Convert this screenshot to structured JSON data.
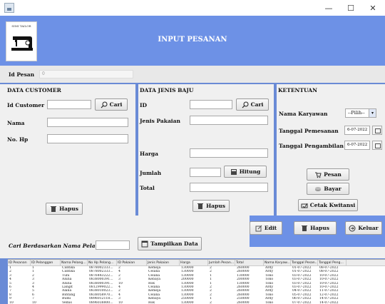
{
  "window": {
    "minimize": "—",
    "maximize": "☐",
    "close": "✕"
  },
  "header": {
    "logo_text": "SIMI TAILOR",
    "title": "INPUT PESANAN"
  },
  "id_pesan": {
    "label": "Id Pesan",
    "value": "0"
  },
  "customer": {
    "title": "DATA CUSTOMER",
    "id_label": "Id Customer",
    "name_label": "Nama",
    "phone_label": "No. Hp",
    "search_button": "Cari",
    "delete_button": "Hapus"
  },
  "clothing": {
    "title": "DATA JENIS BAJU",
    "id_label": "ID",
    "type_label": "Jenis Pakaian",
    "price_label": "Harga",
    "qty_label": "Jumlah",
    "total_label": "Total",
    "search_button": "Cari",
    "count_button": "Hitung",
    "delete_button": "Hapus"
  },
  "terms": {
    "title": "KETENTUAN",
    "employee_label": "Nama Karyawan",
    "employee_value": "--Pilih--",
    "order_date_label": "Tanggal Pemesanan",
    "order_date_value": "6-07-2022",
    "pickup_date_label": "Tanggal Pengambilan",
    "pickup_date_value": "6-07-2022",
    "order_button": "Pesan",
    "pay_button": "Bayar",
    "print_button": "Cetak Kwitansi"
  },
  "actions": {
    "edit": "Edit",
    "delete": "Hapus",
    "exit": "Keluar"
  },
  "search": {
    "label": "Cari Berdasarkan Nama Pelanggan",
    "value": "",
    "show_button": "Tampilkan Data"
  },
  "table": {
    "headers": [
      "ID Pesanan",
      "ID Pelanggan",
      "Nama Pelang...",
      "No Hp Pelang...",
      "ID Pakaian",
      "Jenis Pakaian",
      "Harga",
      "Jumlah Pesan...",
      "Total",
      "Nama Karyaw...",
      "Tanggal Pesan...",
      "Tanggal Peng..."
    ],
    "rows": [
      [
        "1",
        "1",
        "Cantika",
        "0878002333...",
        "2",
        "Kemeja",
        "130000",
        "2",
        "260000",
        "Ardy",
        "01-07-2022",
        "08-07-2022"
      ],
      [
        "2",
        "1",
        "Cantika",
        "0878002333...",
        "4",
        "Celana",
        "130000",
        "2",
        "260000",
        "Ardy",
        "01-07-2022",
        "08-07-2022"
      ],
      [
        "3",
        "2",
        "Tuni",
        "0876443222...",
        "2",
        "Celana",
        "130000",
        "1",
        "130000",
        "Tono",
        "03-07-2022",
        "10-07-2022"
      ],
      [
        "4",
        "3",
        "Aluna",
        "0838000391...",
        "3",
        "Kebaya",
        "200000",
        "1",
        "200000",
        "Tono",
        "03-07-2022",
        "10-07-2022"
      ],
      [
        "5",
        "3",
        "Aluna",
        "0838000391...",
        "10",
        "Rok",
        "130000",
        "1",
        "130000",
        "Tono",
        "03-07-2022",
        "10-07-2022"
      ],
      [
        "6",
        "4",
        "Langit",
        "0812999022...",
        "4",
        "Celana",
        "130000",
        "2",
        "260000",
        "Ardy",
        "03-07-2022",
        "10-07-2022"
      ],
      [
        "7",
        "5",
        "Alana",
        "0838010023...",
        "2",
        "Kemeja",
        "130000",
        "2",
        "260000",
        "Ardy",
        "04-07-2022",
        "11-07-2022"
      ],
      [
        "8",
        "6",
        "Bintang",
        "0838058970...",
        "4",
        "Celana",
        "130000",
        "2",
        "260000",
        "Tono",
        "05-07-2022",
        "12-07-2022"
      ],
      [
        "9",
        "7",
        "Bumi",
        "0896012118...",
        "3",
        "Kebaya",
        "250000",
        "1",
        "250000",
        "Ardy",
        "06-07-2022",
        "14-07-2022"
      ],
      [
        "10",
        "10",
        "Vemis",
        "0896038800...",
        "10",
        "Rok",
        "130000",
        "2",
        "260000",
        "Tono",
        "07-07-2022",
        "14-07-2022"
      ]
    ]
  }
}
